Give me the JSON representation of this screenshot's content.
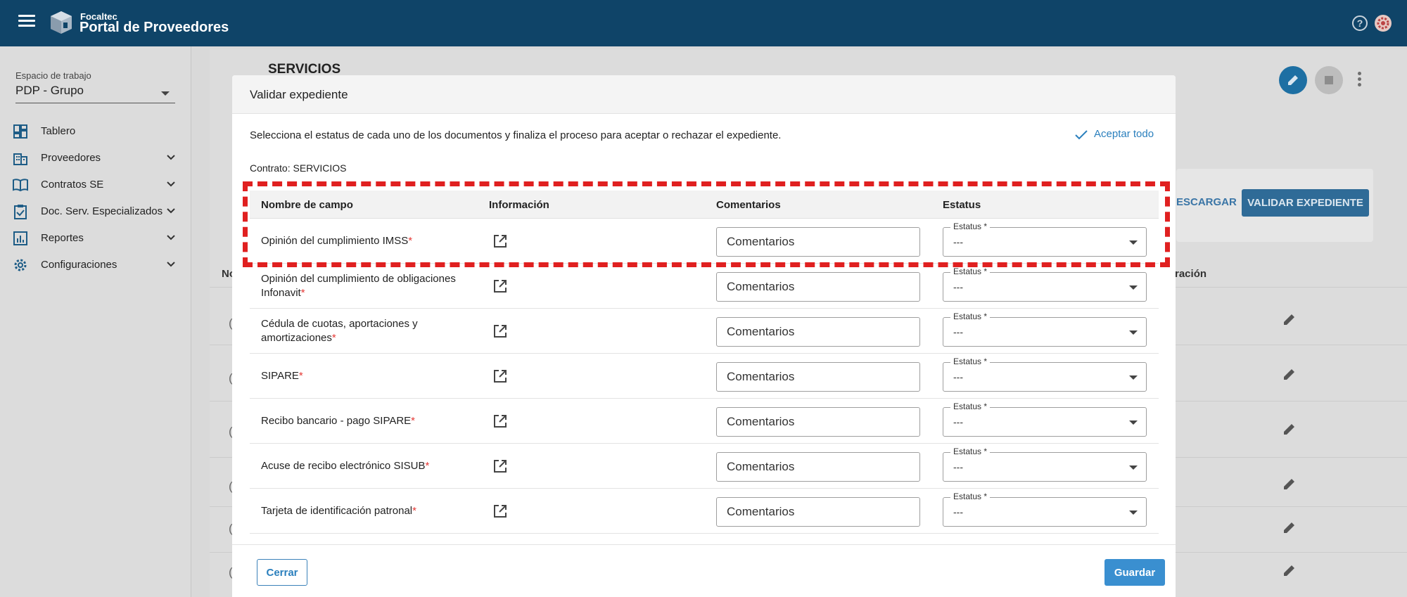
{
  "topbar": {
    "brand_small": "Focaltec",
    "brand_big": "Portal de Proveedores",
    "help_glyph": "?",
    "icons": [
      "menu-icon",
      "box-logo-icon",
      "help-icon",
      "user-gear-icon"
    ]
  },
  "sidebar": {
    "workspace_label": "Espacio de trabajo",
    "workspace_value": "PDP - Grupo",
    "items": [
      {
        "label": "Tablero",
        "icon": "dashboard-icon",
        "expandable": false
      },
      {
        "label": "Proveedores",
        "icon": "building-icon",
        "expandable": true
      },
      {
        "label": "Contratos SE",
        "icon": "book-icon",
        "expandable": true
      },
      {
        "label": "Doc. Serv. Especializados",
        "icon": "clipboard-check-icon",
        "expandable": true
      },
      {
        "label": "Reportes",
        "icon": "chart-icon",
        "expandable": true
      },
      {
        "label": "Configuraciones",
        "icon": "gear-icon",
        "expandable": true
      }
    ]
  },
  "background": {
    "page_title": "SERVICIOS",
    "descargar_label": "ESCARGAR",
    "validar_label": "VALIDAR EXPEDIENTE",
    "col_no": "No",
    "col_operacion": "ración",
    "row_glyph": "("
  },
  "modal": {
    "title": "Validar expediente",
    "instructions": "Selecciona el estatus de cada uno de los documentos y finaliza el proceso para aceptar o rechazar el expediente.",
    "accept_all": "Aceptar todo",
    "contrato": "Contrato: SERVICIOS",
    "columns": {
      "campo": "Nombre de campo",
      "info": "Información",
      "comentarios": "Comentarios",
      "estatus": "Estatus"
    },
    "comment_placeholder": "Comentarios",
    "status_label": "Estatus *",
    "status_value": "---",
    "required_mark": "*",
    "rows": [
      {
        "line1": "Opinión del cumplimiento IMSS",
        "line2": ""
      },
      {
        "line1": "Opinión del cumplimiento de obligaciones",
        "line2": "Infonavit"
      },
      {
        "line1": "Cédula de cuotas, aportaciones y",
        "line2": "amortizaciones"
      },
      {
        "line1": "SIPARE",
        "line2": ""
      },
      {
        "line1": "Recibo bancario - pago SIPARE",
        "line2": ""
      },
      {
        "line1": "Acuse de recibo electrónico SISUB",
        "line2": ""
      },
      {
        "line1": "Tarjeta de identificación patronal",
        "line2": ""
      }
    ],
    "cerrar": "Cerrar",
    "guardar": "Guardar"
  },
  "colors": {
    "topbar": "#0f4468",
    "accent": "#3a8fd0",
    "required": "#e53935",
    "highlight": "#e02020"
  }
}
